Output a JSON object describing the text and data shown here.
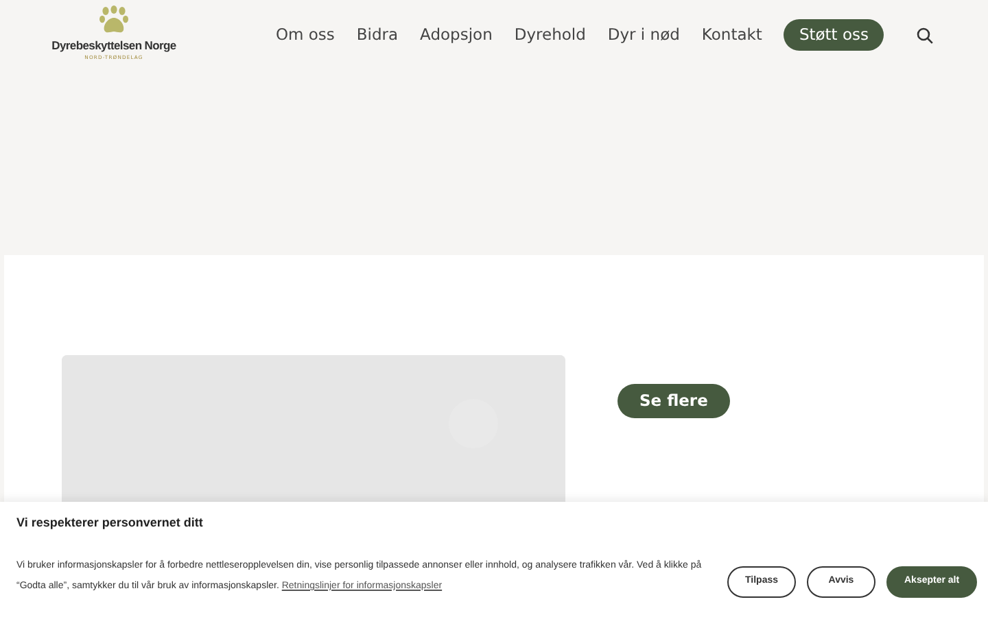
{
  "logo": {
    "name": "Dyrebeskyttelsen Norge",
    "region": "NORD-TRØNDELAG"
  },
  "nav": {
    "items": [
      {
        "label": "Om oss"
      },
      {
        "label": "Bidra"
      },
      {
        "label": "Adopsjon"
      },
      {
        "label": "Dyrehold"
      },
      {
        "label": "Dyr i nød"
      },
      {
        "label": "Kontakt"
      }
    ],
    "cta": "Støtt oss"
  },
  "content": {
    "button": "Se flere"
  },
  "cookie_banner": {
    "title": "Vi respekterer personvernet ditt",
    "text": "Vi bruker informasjonskapsler for å forbedre nettleseropplevelsen din, vise personlig tilpassede annonser eller innhold, og analysere trafikken vår. Ved å klikke på “Godta alle”, samtykker du til vår bruk av informasjonskapsler.",
    "link": "Retningslinjer for informasjonskapsler",
    "buttons": [
      {
        "label": "Tilpass",
        "kind": "outline"
      },
      {
        "label": "Avvis",
        "kind": "outline"
      },
      {
        "label": "Aksepter alt",
        "kind": "primary"
      }
    ]
  }
}
